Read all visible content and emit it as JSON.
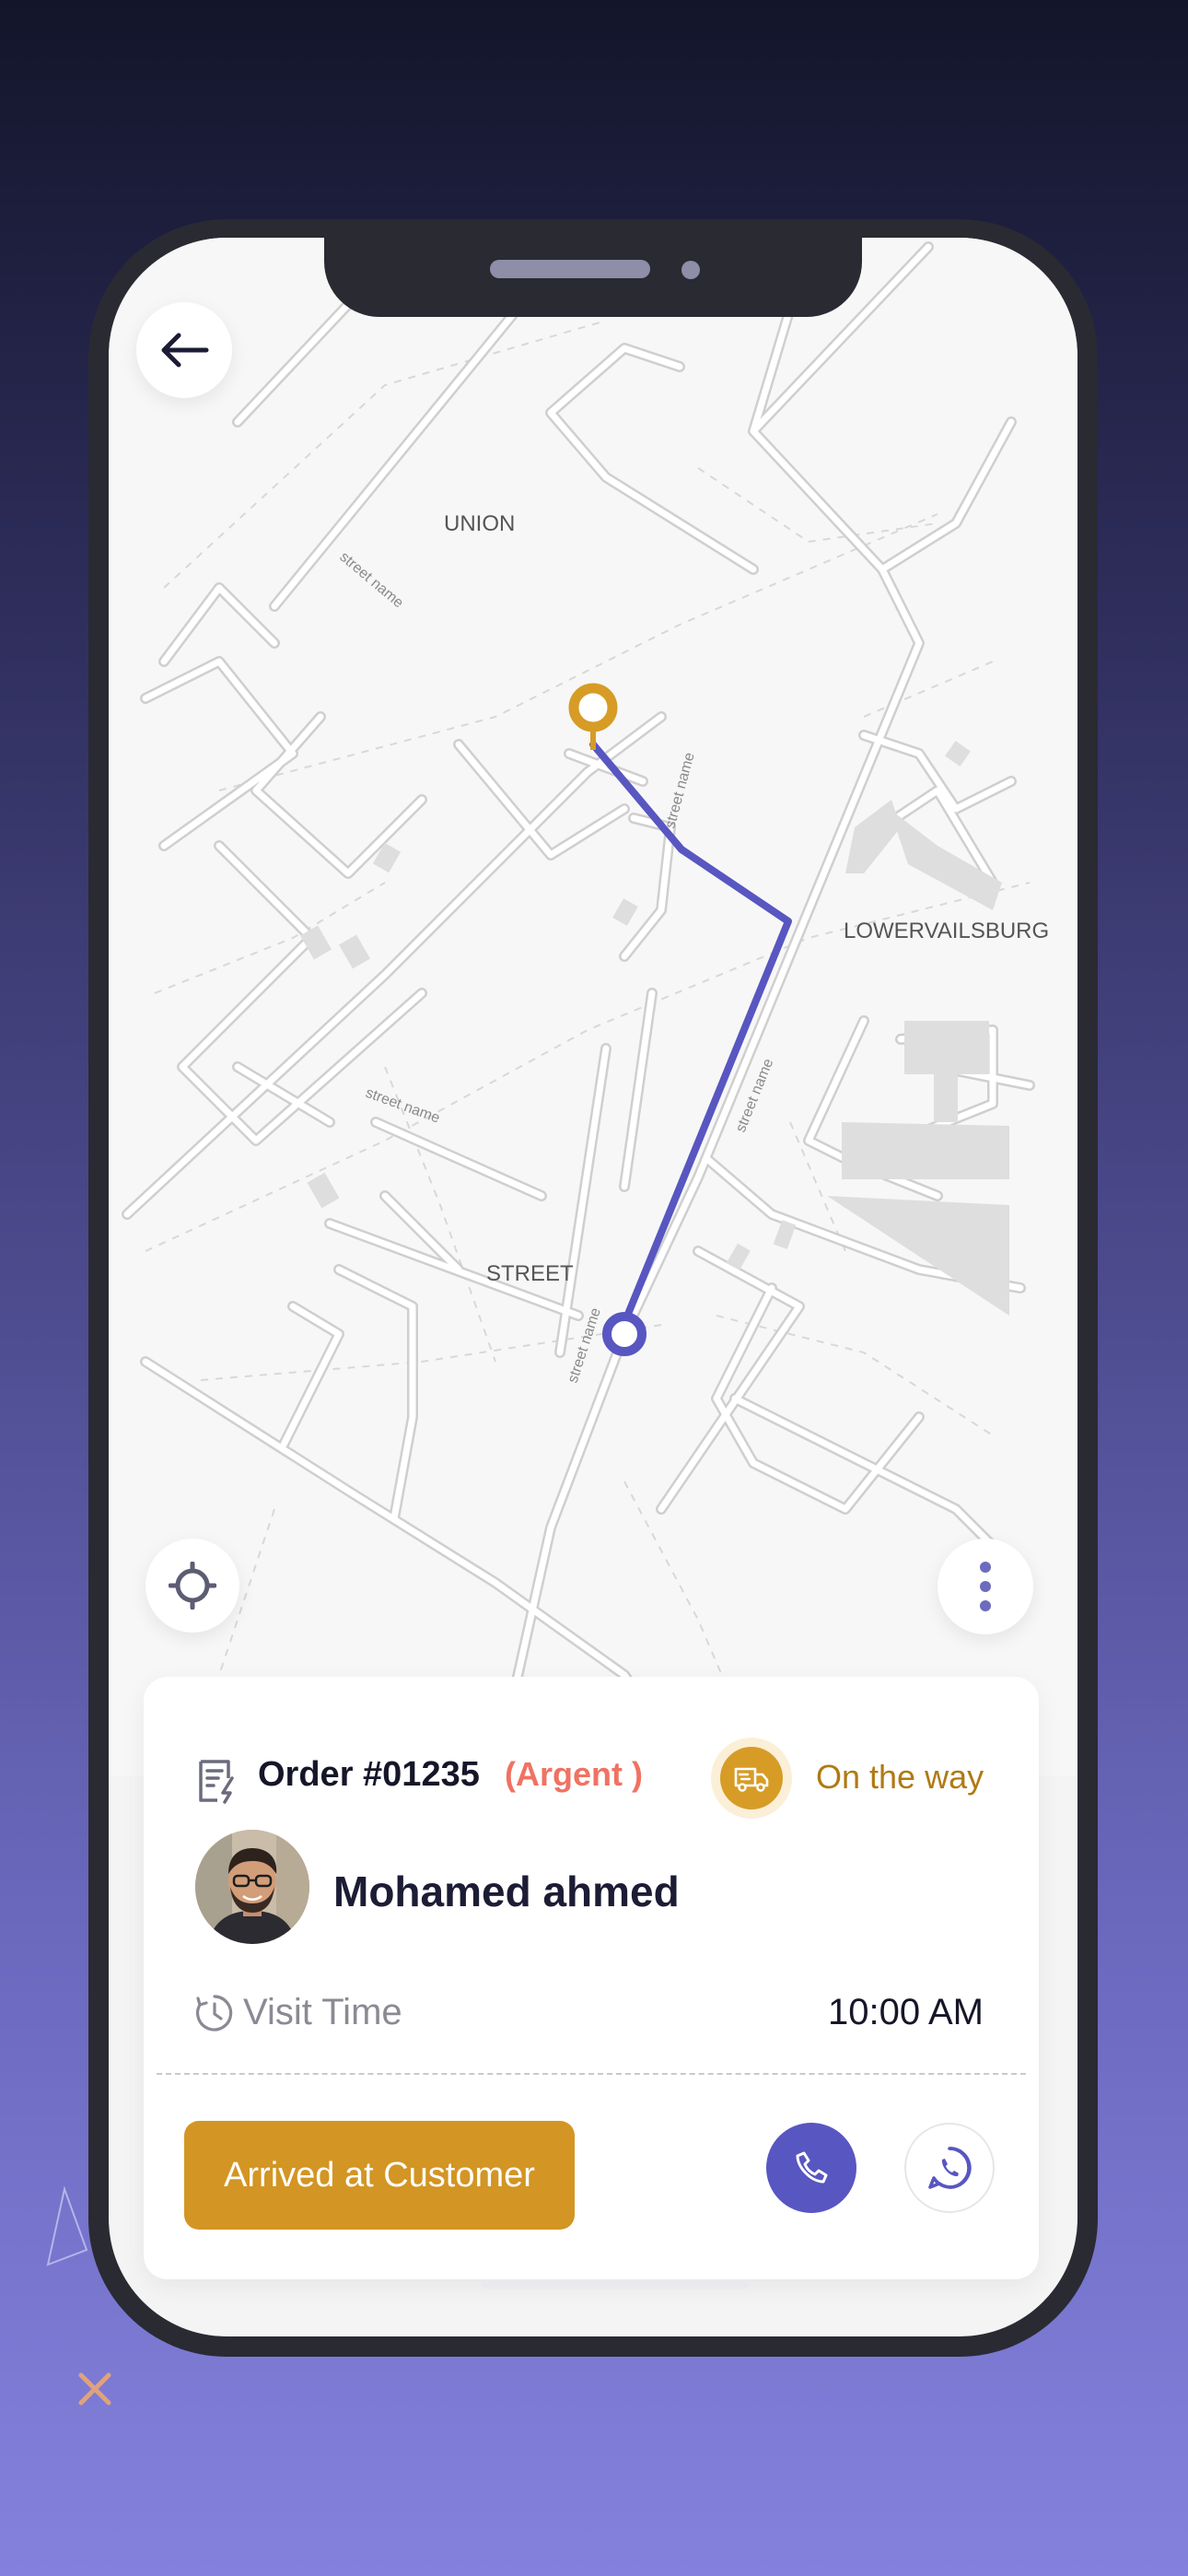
{
  "map": {
    "areas": [
      "UNION",
      "LOWERVAILSBURG",
      "STREET"
    ],
    "street_label": "street name"
  },
  "header": {
    "back_icon": "arrow-left-icon"
  },
  "order": {
    "icon": "order-receipt-icon",
    "title": "Order #01235",
    "tag": "(Argent )",
    "status_icon": "delivery-truck-icon",
    "status": "On the way"
  },
  "customer": {
    "name": "Mohamed ahmed"
  },
  "visit": {
    "icon": "clock-icon",
    "label": "Visit Time",
    "time": "10:00 AM"
  },
  "actions": {
    "arrived_label": "Arrived at Customer",
    "call_icon": "phone-icon",
    "whatsapp_icon": "whatsapp-icon"
  },
  "colors": {
    "route": "#5856c1",
    "destination_pin": "#d69c26",
    "accent": "#d39523",
    "urgent": "#f07263"
  }
}
